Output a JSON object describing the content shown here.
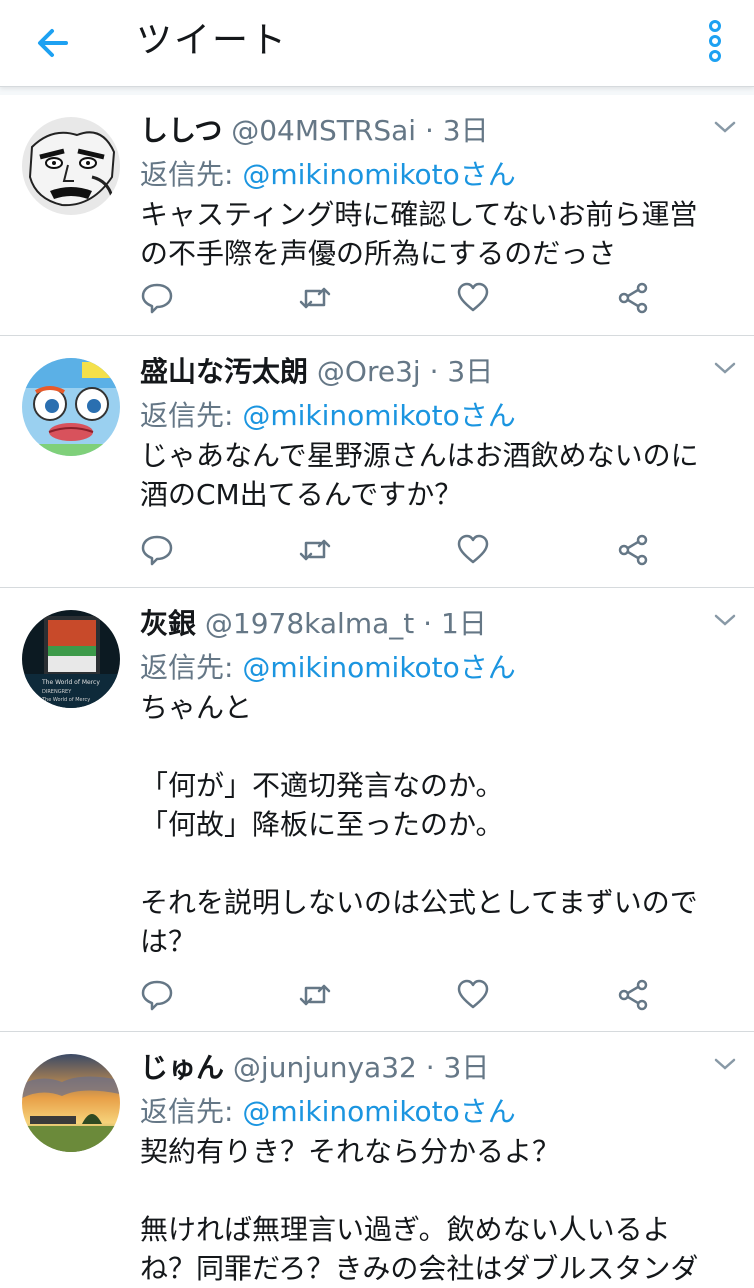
{
  "header": {
    "title": "ツイート"
  },
  "tweets": [
    {
      "name": "ししつ",
      "handle": "@04MSTRSai",
      "sep": "·",
      "time": "3日",
      "reply_prefix": "返信先:",
      "reply_to": "@mikinomikotoさん",
      "lines": [
        "キャスティング時に確認してないお前ら運営",
        "の不手際を声優の所為にするのだっさ"
      ]
    },
    {
      "name": "盛山な汚太朗",
      "handle": "@Ore3j",
      "sep": "·",
      "time": "3日",
      "reply_prefix": "返信先:",
      "reply_to": "@mikinomikotoさん",
      "lines": [
        "じゃあなんで星野源さんはお酒飲めないのに",
        "酒のCM出てるんですか？"
      ]
    },
    {
      "name": "灰銀",
      "handle": "@1978kalma_t",
      "sep": "·",
      "time": "1日",
      "reply_prefix": "返信先:",
      "reply_to": "@mikinomikotoさん",
      "lines": [
        "ちゃんと",
        "",
        "「何が」不適切発言なのか。",
        "「何故」降板に至ったのか。",
        "",
        "それを説明しないのは公式としてまずいので",
        "は？"
      ],
      "avatar_text": [
        "The World of Mercy",
        "DIRENGREY",
        "The World of Mercy"
      ]
    },
    {
      "name": "じゅん",
      "handle": "@junjunya32",
      "sep": "·",
      "time": "3日",
      "reply_prefix": "返信先:",
      "reply_to": "@mikinomikotoさん",
      "lines": [
        "契約有りき？それなら分かるよ？",
        "",
        "無ければ無理言い過ぎ。飲めない人いるよ",
        "ね？同罪だろ？きみの会社はダブルスタンダ"
      ]
    }
  ],
  "colors": {
    "accent": "#1b95e0",
    "secondary_text": "#657786",
    "divider": "#d6dadd"
  }
}
